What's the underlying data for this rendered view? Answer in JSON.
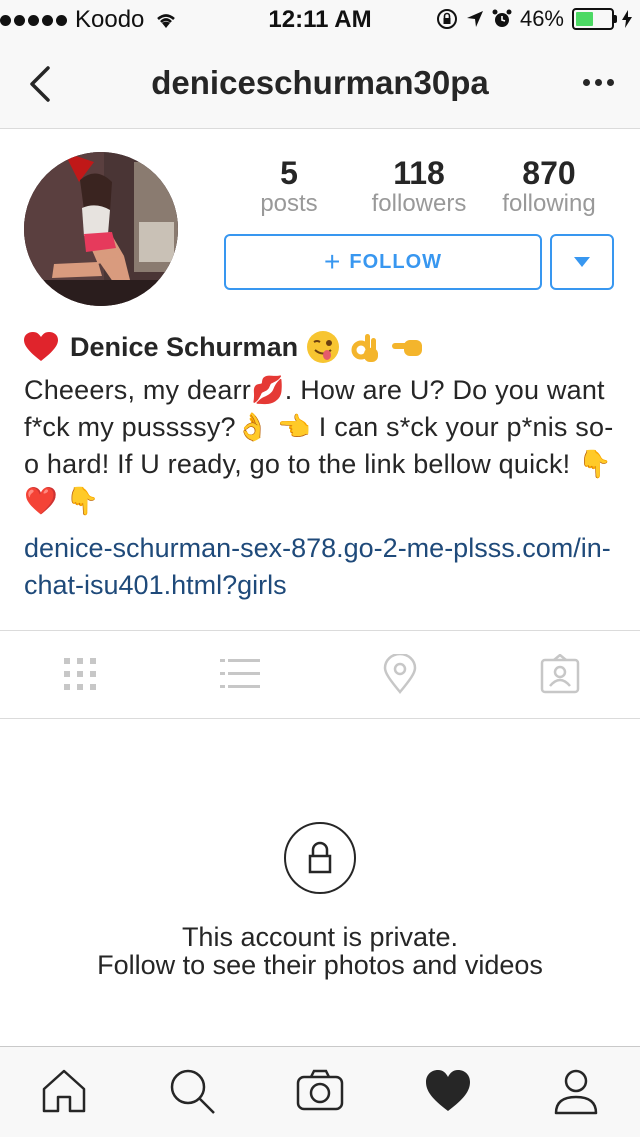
{
  "status_bar": {
    "carrier": "Koodo",
    "time": "12:11 AM",
    "battery": "46%",
    "battery_level": 0.46
  },
  "nav": {
    "title": "deniceschurman30pa",
    "back_icon": "chevron-left-icon",
    "more_icon": "more-horizontal-icon"
  },
  "profile": {
    "stats": [
      {
        "value": "5",
        "label": "posts"
      },
      {
        "value": "118",
        "label": "followers"
      },
      {
        "value": "870",
        "label": "following"
      }
    ],
    "follow_label": "FOLLOW",
    "follow_plus": "+",
    "name": "Denice Schurman",
    "bio": "Cheeers, my dearr💋. How are U? Do you want f*ck my pussssy?👌 👈 I can s*ck your p*nis so-o hard! If U ready, go to the link bellow quick! 👇 ❤️ 👇",
    "link": "denice-schurman-sex-878.go-2-me-plsss.com/in-chat-isu401.html?girls"
  },
  "colors": {
    "accent": "#3897f0",
    "link": "#1f4a7a",
    "text": "#262626",
    "muted": "#999999"
  },
  "private": {
    "line1": "This account is private.",
    "line2": "Follow to see their photos and videos"
  }
}
